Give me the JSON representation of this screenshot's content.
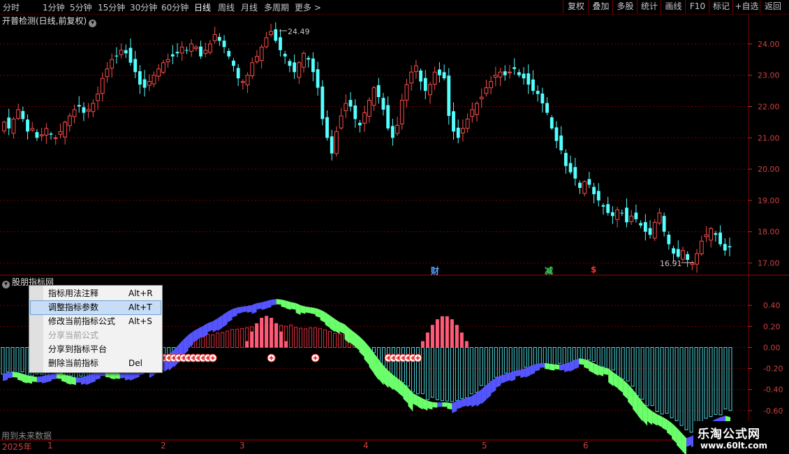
{
  "toolbar": {
    "periods": [
      "分时",
      "1分钟",
      "5分钟",
      "15分钟",
      "30分钟",
      "60分钟",
      "日线",
      "周线",
      "月线",
      "多周期",
      "更多 >"
    ],
    "active_period": "日线",
    "tools": [
      "复权",
      "叠加",
      "多股",
      "统计",
      "画线",
      "F10",
      "标记",
      "+自选",
      "返回"
    ]
  },
  "chart": {
    "title": "开普检测(日线,前复权)",
    "high_label": "24.49",
    "low_label": "16.91",
    "markers": [
      {
        "text": "财",
        "color": "#5aa0ff"
      },
      {
        "text": "减",
        "color": "#40d060"
      },
      {
        "text": "$",
        "color": "#ff3030"
      }
    ]
  },
  "indicator": {
    "title": "股朋指标网"
  },
  "context_menu": {
    "items": [
      {
        "label": "指标用法注释",
        "shortcut": "Alt+R",
        "state": "normal"
      },
      {
        "label": "调整指标参数",
        "shortcut": "Alt+T",
        "state": "selected"
      },
      {
        "label": "修改当前指标公式",
        "shortcut": "Alt+S",
        "state": "normal"
      },
      {
        "label": "分享当前公式",
        "shortcut": "",
        "state": "disabled"
      },
      {
        "label": "分享到指标平台",
        "shortcut": "",
        "state": "normal"
      },
      {
        "label": "删除当前指标",
        "shortcut": "Del",
        "state": "normal"
      }
    ]
  },
  "footer_note": "用到未来数据",
  "time_axis": [
    "2025年",
    "1",
    "2",
    "3",
    "4",
    "5",
    "6"
  ],
  "watermark": {
    "line1": "乐淘公式网",
    "line2": "www.60lt.com"
  },
  "colors": {
    "up": "#ff4d4d",
    "down": "#54ffff",
    "grid": "#7a0000",
    "green": "#6bff6b",
    "blue": "#5555ff",
    "pink": "#ff5a78"
  },
  "chart_data": [
    {
      "type": "candlestick",
      "title": "开普检测(日线,前复权)",
      "ylim": [
        16.7,
        24.6
      ],
      "y_ticks": [
        24.0,
        23.0,
        22.0,
        21.0,
        20.0,
        19.0,
        18.0,
        17.0
      ],
      "closes": [
        21.5,
        21.3,
        21.6,
        21.9,
        21.6,
        21.2,
        21.3,
        21.0,
        21.1,
        21.3,
        21.1,
        21.0,
        21.2,
        21.5,
        21.7,
        21.9,
        22.0,
        21.8,
        21.9,
        22.1,
        22.4,
        22.9,
        23.2,
        23.5,
        23.6,
        23.8,
        23.7,
        23.4,
        23.1,
        22.7,
        22.6,
        22.8,
        23.0,
        23.2,
        23.4,
        23.5,
        23.6,
        23.7,
        23.9,
        23.8,
        24.0,
        23.9,
        23.6,
        23.8,
        24.0,
        24.3,
        24.1,
        23.9,
        23.6,
        23.3,
        22.9,
        22.8,
        23.0,
        23.4,
        23.6,
        23.9,
        24.2,
        24.4,
        24.1,
        23.8,
        23.6,
        23.3,
        23.1,
        23.4,
        23.7,
        23.5,
        23.1,
        22.6,
        21.6,
        21.0,
        20.5,
        21.2,
        21.7,
        22.1,
        22.0,
        21.6,
        21.4,
        21.8,
        22.2,
        22.6,
        22.3,
        21.9,
        21.3,
        21.0,
        21.4,
        22.2,
        22.7,
        23.1,
        23.3,
        22.8,
        22.5,
        22.7,
        23.1,
        23.0,
        22.9,
        21.7,
        21.2,
        21.0,
        21.3,
        21.6,
        21.9,
        22.1,
        22.3,
        22.6,
        22.8,
        23.0,
        23.1,
        23.0,
        23.1,
        23.2,
        23.0,
        22.9,
        22.7,
        22.5,
        22.4,
        22.1,
        21.8,
        21.3,
        20.9,
        20.6,
        20.1,
        19.9,
        19.7,
        19.4,
        19.6,
        19.5,
        19.2,
        19.0,
        18.8,
        18.6,
        18.5,
        18.7,
        18.6,
        18.3,
        18.5,
        18.4,
        18.2,
        18.0,
        17.9,
        18.3,
        18.6,
        18.0,
        17.6,
        17.3,
        17.2,
        17.4,
        17.1,
        17.0,
        17.3,
        17.7,
        17.9,
        18.1,
        17.9,
        17.6,
        17.4,
        17.5
      ]
    },
    {
      "type": "bar",
      "title": "股朋指标网",
      "ylim": [
        -0.76,
        0.66
      ],
      "y_ticks": [
        0.4,
        0.2,
        0.0,
        -0.2,
        -0.4,
        -0.6
      ]
    }
  ]
}
